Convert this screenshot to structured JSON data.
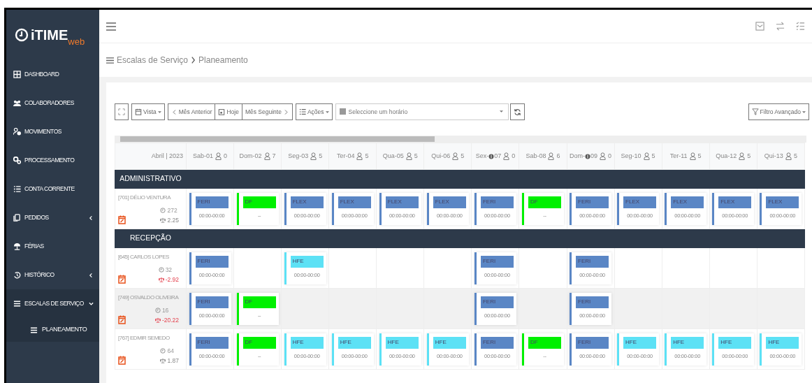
{
  "logo": {
    "main": "iTIME",
    "sub": "web"
  },
  "sidebar": {
    "items": [
      {
        "label": "DASHBOARD",
        "submenu": false
      },
      {
        "label": "COLABORADORES",
        "submenu": false
      },
      {
        "label": "MOVIMENTOS",
        "submenu": false
      },
      {
        "label": "PROCESSAMENTO",
        "submenu": false
      },
      {
        "label": "CONTA CORRENTE",
        "submenu": false
      },
      {
        "label": "PEDIDOS",
        "submenu": true,
        "expanded": false
      },
      {
        "label": "FÉRIAS",
        "submenu": false
      },
      {
        "label": "HISTÓRICO",
        "submenu": true,
        "expanded": false
      },
      {
        "label": "ESCALAS DE SERVIÇO",
        "submenu": true,
        "expanded": true,
        "children": [
          {
            "label": "PLANEAMENTO"
          }
        ]
      }
    ]
  },
  "breadcrumb": [
    "Escalas de Serviço",
    "Planeamento"
  ],
  "toolbar": {
    "buttons": [
      {
        "label": "Vista",
        "dropdown": true
      },
      {
        "label": "Mês Anterior",
        "dropdown": false
      },
      {
        "label": "Hoje",
        "dropdown": false
      },
      {
        "label": "Mês Seguinte",
        "dropdown": false
      },
      {
        "label": "Ações",
        "dropdown": true
      }
    ],
    "schedule_select": {
      "placeholder": "Seleccione um horário"
    },
    "filter": {
      "label": "Filtro Avançado"
    }
  },
  "table": {
    "month": "Abril | 2023",
    "days": [
      {
        "weekday": "Sab-",
        "day": "01",
        "holiday": false,
        "count": "0"
      },
      {
        "weekday": "Dom-",
        "day": "02",
        "holiday": false,
        "count": "7"
      },
      {
        "weekday": "Seg-",
        "day": "03",
        "holiday": false,
        "count": "5"
      },
      {
        "weekday": "Ter-",
        "day": "04",
        "holiday": false,
        "count": "5"
      },
      {
        "weekday": "Qua-",
        "day": "05",
        "holiday": false,
        "count": "5"
      },
      {
        "weekday": "Qui-",
        "day": "06",
        "holiday": false,
        "count": "5"
      },
      {
        "weekday": "Sex-",
        "day": "07",
        "holiday": true,
        "count": "0"
      },
      {
        "weekday": "Sab-",
        "day": "08",
        "holiday": false,
        "count": "6"
      },
      {
        "weekday": "Dom-",
        "day": "09",
        "holiday": true,
        "count": "0"
      },
      {
        "weekday": "Seg-",
        "day": "10",
        "holiday": false,
        "count": "5"
      },
      {
        "weekday": "Ter-",
        "day": "11",
        "holiday": false,
        "count": "5"
      },
      {
        "weekday": "Qua-",
        "day": "12",
        "holiday": false,
        "count": "5"
      },
      {
        "weekday": "Qui-",
        "day": "13",
        "holiday": false,
        "count": "5"
      }
    ],
    "groups": [
      {
        "name": "ADMINISTRATIVO",
        "employees": [
          {
            "name": "[701] DÉLIO VENTURA",
            "hours": "272",
            "balance": "2.25",
            "negative": false,
            "shifts": [
              {
                "code": "FERI",
                "time": "00:00-00:00",
                "color": "#5a86c5"
              },
              {
                "code": "DF",
                "time": "--",
                "color": "#00f000"
              },
              {
                "code": "FLEX",
                "time": "00:00-00:00",
                "color": "#5a86c5"
              },
              {
                "code": "FLEX",
                "time": "00:00-00:00",
                "color": "#5a86c5"
              },
              {
                "code": "FLEX",
                "time": "00:00-00:00",
                "color": "#5a86c5"
              },
              {
                "code": "FLEX",
                "time": "00:00-00:00",
                "color": "#5a86c5"
              },
              {
                "code": "FERI",
                "time": "00:00-00:00",
                "color": "#5a86c5"
              },
              {
                "code": "DF",
                "time": "--",
                "color": "#00f000"
              },
              {
                "code": "FERI",
                "time": "00:00-00:00",
                "color": "#5a86c5"
              },
              {
                "code": "FLEX",
                "time": "00:00-00:00",
                "color": "#5a86c5"
              },
              {
                "code": "FLEX",
                "time": "00:00-00:00",
                "color": "#5a86c5"
              },
              {
                "code": "FLEX",
                "time": "00:00-00:00",
                "color": "#5a86c5"
              },
              {
                "code": "FLEX",
                "time": "00:00-00:00",
                "color": "#5a86c5"
              }
            ]
          }
        ]
      },
      {
        "name": "RECEPÇÃO",
        "employees": [
          {
            "name": "[645] CARLOS LOPES",
            "hours": "32",
            "balance": "-2.92",
            "negative": true,
            "shifts": [
              {
                "code": "FERI",
                "time": "00:00-00:00",
                "color": "#5a86c5"
              },
              {
                "kind": "empty"
              },
              {
                "code": "HFE",
                "time": "00:00-00:00",
                "color": "#5ce1f5"
              },
              {
                "kind": "empty"
              },
              {
                "kind": "empty"
              },
              {
                "kind": "empty"
              },
              {
                "code": "FERI",
                "time": "00:00-00:00",
                "color": "#5a86c5"
              },
              {
                "kind": "empty"
              },
              {
                "code": "FERI",
                "time": "00:00-00:00",
                "color": "#5a86c5"
              },
              {
                "kind": "empty"
              },
              {
                "kind": "empty"
              },
              {
                "kind": "empty"
              },
              {
                "kind": "empty"
              }
            ]
          },
          {
            "name": "[749] OSVALDO OLIVEIRA",
            "hours": "16",
            "balance": "-20.22",
            "negative": true,
            "shifts": [
              {
                "code": "FERI",
                "time": "00:00-00:00",
                "color": "#5a86c5"
              },
              {
                "code": "DF",
                "time": "--",
                "color": "#00f000"
              },
              {
                "kind": "empty"
              },
              {
                "kind": "empty"
              },
              {
                "kind": "empty"
              },
              {
                "kind": "empty"
              },
              {
                "code": "FERI",
                "time": "00:00-00:00",
                "color": "#5a86c5"
              },
              {
                "kind": "empty"
              },
              {
                "code": "FERI",
                "time": "00:00-00:00",
                "color": "#5a86c5"
              },
              {
                "kind": "empty"
              },
              {
                "kind": "empty"
              },
              {
                "kind": "empty"
              },
              {
                "kind": "empty"
              }
            ]
          },
          {
            "name": "[767] EDMIR SEMEDO",
            "hours": "64",
            "balance": "1.87",
            "negative": false,
            "shifts": [
              {
                "code": "FERI",
                "time": "00:00-00:00",
                "color": "#5a86c5"
              },
              {
                "code": "DF",
                "time": "--",
                "color": "#00f000"
              },
              {
                "code": "HFE",
                "time": "00:00-00:00",
                "color": "#5ce1f5"
              },
              {
                "code": "HFE",
                "time": "00:00-00:00",
                "color": "#5ce1f5"
              },
              {
                "code": "HFE",
                "time": "00:00-00:00",
                "color": "#5ce1f5"
              },
              {
                "code": "HFE",
                "time": "00:00-00:00",
                "color": "#5ce1f5"
              },
              {
                "code": "FERI",
                "time": "00:00-00:00",
                "color": "#5a86c5"
              },
              {
                "code": "DF",
                "time": "--",
                "color": "#00f000"
              },
              {
                "code": "FERI",
                "time": "00:00-00:00",
                "color": "#5a86c5"
              },
              {
                "code": "HFE",
                "time": "00:00-00:00",
                "color": "#5ce1f5"
              },
              {
                "code": "HFE",
                "time": "00:00-00:00",
                "color": "#5ce1f5"
              },
              {
                "code": "HFE",
                "time": "00:00-00:00",
                "color": "#5ce1f5"
              },
              {
                "code": "HFE",
                "time": "00:00-00:00",
                "color": "#5ce1f5"
              }
            ]
          }
        ]
      }
    ]
  }
}
